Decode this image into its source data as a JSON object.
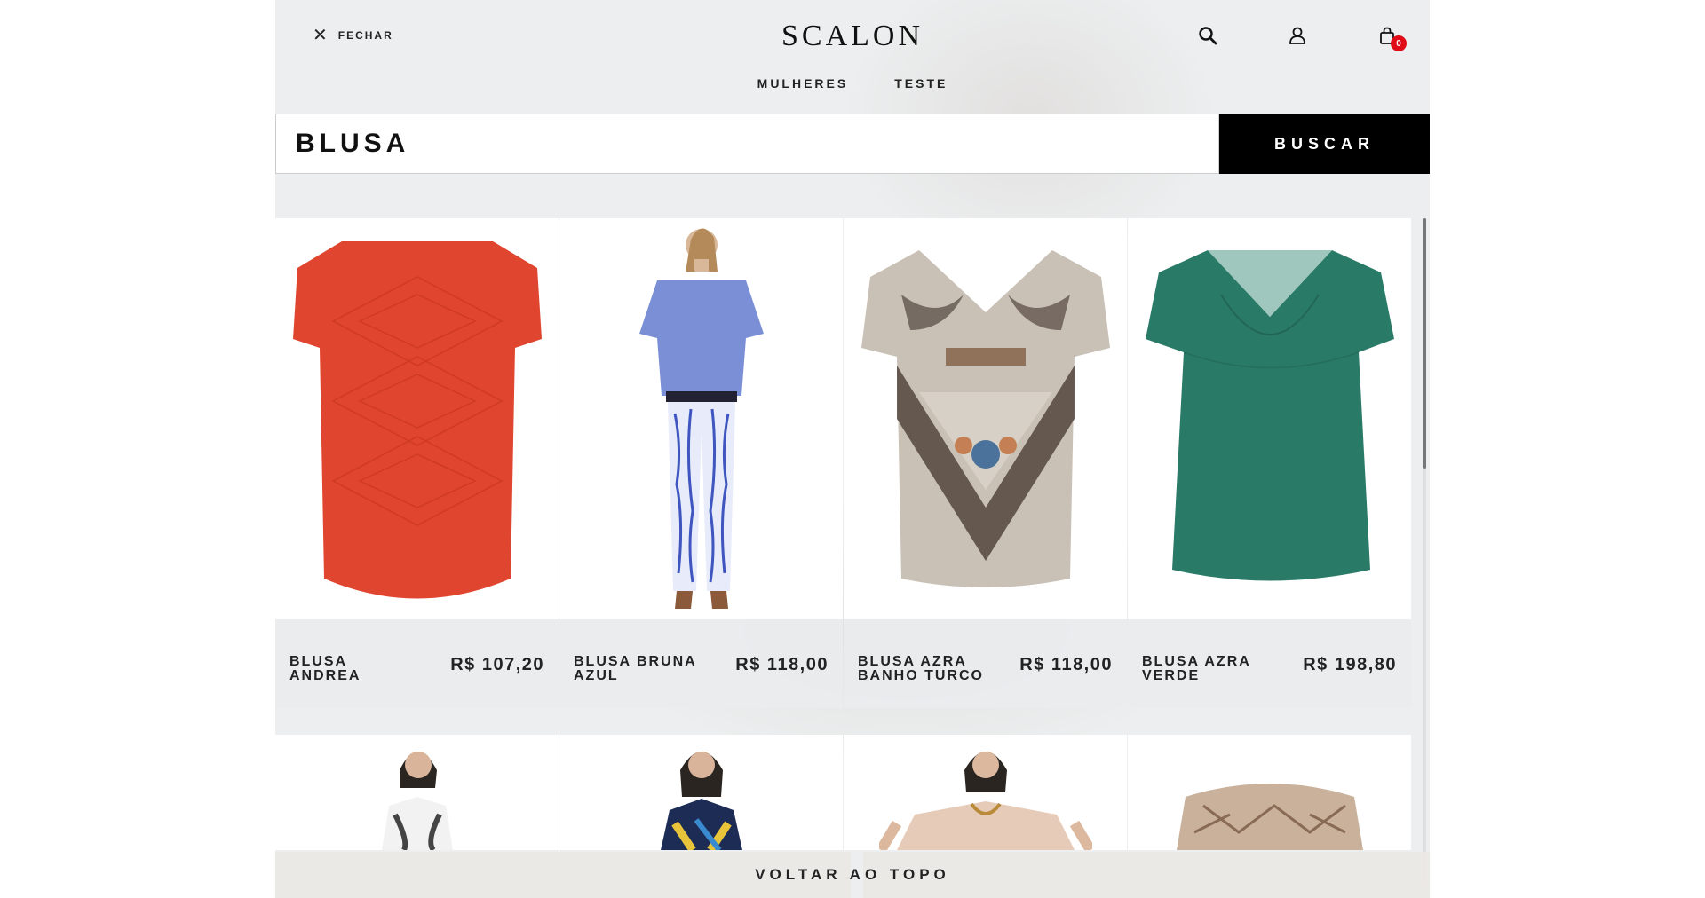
{
  "header": {
    "close_label": "FECHAR",
    "logo": "SCALON",
    "nav": [
      "MULHERES",
      "TESTE"
    ],
    "cart_count": "0"
  },
  "search": {
    "value": "BLUSA",
    "button_label": "BUSCAR"
  },
  "products": [
    {
      "name": "BLUSA ANDREA",
      "price": "R$ 107,20",
      "color": "#e0452f",
      "type": "shirt"
    },
    {
      "name": "BLUSA BRUNA AZUL",
      "price": "R$ 118,00",
      "color": "#7b8fd6",
      "type": "model"
    },
    {
      "name": "BLUSA AZRA BANHO TURCO",
      "price": "R$ 118,00",
      "color": "#8a7a6a",
      "type": "shirt-print"
    },
    {
      "name": "BLUSA AZRA VERDE",
      "price": "R$ 198,80",
      "color": "#2a7a68",
      "type": "shirt"
    }
  ],
  "back_to_top": "VOLTAR AO TOPO"
}
